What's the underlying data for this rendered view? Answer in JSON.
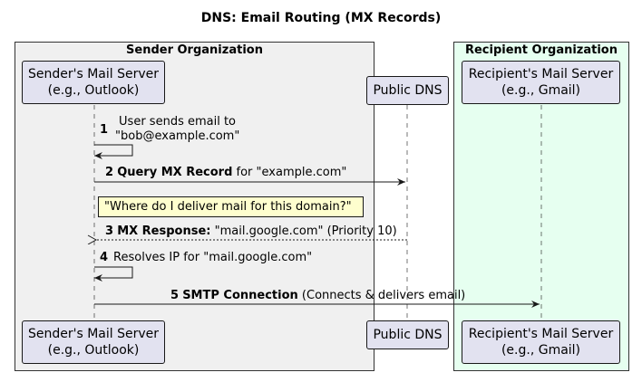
{
  "title": "DNS: Email Routing (MX Records)",
  "groups": {
    "sender": {
      "title": "Sender Organization",
      "bg": "#f0f0f0"
    },
    "recipient": {
      "title": "Recipient Organization",
      "bg": "#e6fff0"
    }
  },
  "participants": {
    "sender": {
      "line1": "Sender's Mail Server",
      "line2": "(e.g., Outlook)"
    },
    "dns": {
      "line1": "Public DNS"
    },
    "recipient": {
      "line1": "Recipient's Mail Server",
      "line2": "(e.g., Gmail)"
    }
  },
  "messages": [
    {
      "num": "1",
      "bold": "",
      "line1": "User sends email to",
      "line2": "\"bob@example.com\""
    },
    {
      "num": "2",
      "bold": "Query MX Record",
      "text": " for \"example.com\""
    },
    {
      "num": "3",
      "bold": "MX Response:",
      "text": " \"mail.google.com\" (Priority 10)"
    },
    {
      "num": "4",
      "bold": "",
      "text": "Resolves IP for \"mail.google.com\""
    },
    {
      "num": "5",
      "bold": "SMTP Connection",
      "text": " (Connects & delivers email)"
    }
  ],
  "note": {
    "text": "\"Where do I deliver mail for this domain?\""
  },
  "colors": {
    "participant_bg": "#e2e2f0",
    "note_bg": "#fefece",
    "line": "#181818"
  }
}
